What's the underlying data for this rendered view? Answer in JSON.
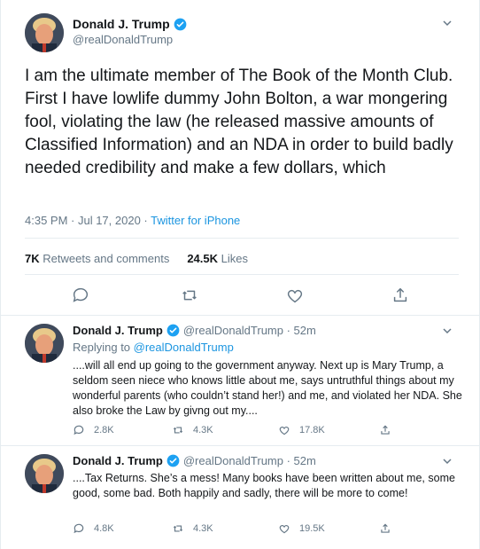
{
  "main_tweet": {
    "name": "Donald J. Trump",
    "handle": "@realDonaldTrump",
    "text": "I am the ultimate member of The Book of the Month Club. First I have lowlife dummy John Bolton, a war mongering fool, violating the law (he released massive amounts of Classified Information) and an NDA in order to build badly needed credibility and make a few dollars, which",
    "timestamp": "4:35 PM · Jul 17, 2020 · ",
    "source": "Twitter for iPhone",
    "retweets_count": "7K",
    "retweets_label": "Retweets and comments",
    "likes_count": "24.5K",
    "likes_label": "Likes"
  },
  "replies": [
    {
      "name": "Donald J. Trump",
      "handle_time": "@realDonaldTrump · 52m",
      "replying_prefix": "Replying to ",
      "replying_handle": "@realDonaldTrump",
      "text": "....will all end up going to the government anyway. Next up is Mary Trump, a seldom seen niece who knows little about me, says untruthful things about my wonderful parents (who couldn’t stand her!) and me, and violated her NDA. She also broke the Law by givng out my....",
      "comments": "2.8K",
      "retweets": "4.3K",
      "likes": "17.8K"
    },
    {
      "name": "Donald J. Trump",
      "handle_time": "@realDonaldTrump · 52m",
      "text": "....Tax Returns. She’s a mess! Many books have been written about me, some good, some bad. Both happily and sadly, there will be more to come!",
      "comments": "4.8K",
      "retweets": "4.3K",
      "likes": "19.5K"
    }
  ],
  "colors": {
    "accent": "#1b95e0",
    "muted": "#657786",
    "text": "#14171a",
    "divider": "#e6ecf0"
  }
}
